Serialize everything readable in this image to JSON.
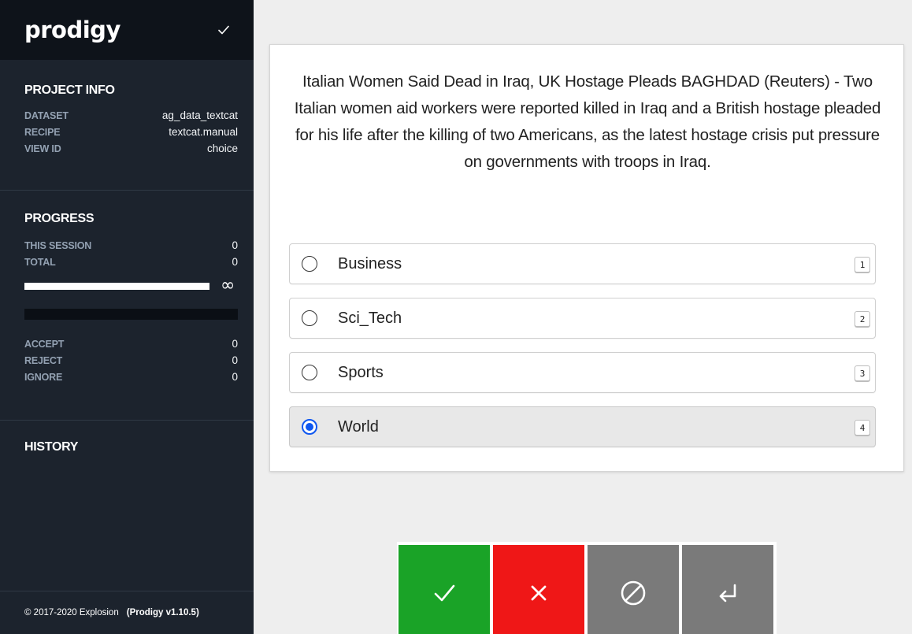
{
  "app": {
    "logo": "prodigy"
  },
  "project_info": {
    "title": "PROJECT INFO",
    "items": [
      {
        "key": "DATASET",
        "value": "ag_data_textcat"
      },
      {
        "key": "RECIPE",
        "value": "textcat.manual"
      },
      {
        "key": "VIEW ID",
        "value": "choice"
      }
    ]
  },
  "progress": {
    "title": "PROGRESS",
    "items": [
      {
        "key": "THIS SESSION",
        "value": "0"
      },
      {
        "key": "TOTAL",
        "value": "0"
      }
    ],
    "infinity_symbol": "∞",
    "counts": [
      {
        "key": "ACCEPT",
        "value": "0"
      },
      {
        "key": "REJECT",
        "value": "0"
      },
      {
        "key": "IGNORE",
        "value": "0"
      }
    ]
  },
  "history": {
    "title": "HISTORY"
  },
  "footer": {
    "copyright": "© 2017-2020 Explosion",
    "version": "(Prodigy v1.10.5)"
  },
  "task": {
    "text": "Italian Women Said Dead in Iraq, UK Hostage Pleads BAGHDAD (Reuters) - Two Italian women aid workers were reported killed in Iraq and a British hostage pleaded for his life after the killing of two Americans, as the latest hostage crisis put pressure on governments with troops in Iraq.",
    "options": [
      {
        "label": "Business",
        "key": "1",
        "selected": false
      },
      {
        "label": "Sci_Tech",
        "key": "2",
        "selected": false
      },
      {
        "label": "Sports",
        "key": "3",
        "selected": false
      },
      {
        "label": "World",
        "key": "4",
        "selected": true
      }
    ]
  },
  "actions": {
    "accept_icon": "check-icon",
    "reject_icon": "x-icon",
    "ignore_icon": "ignore-icon",
    "undo_icon": "undo-icon"
  },
  "colors": {
    "accept": "#1aa327",
    "reject": "#ef1717",
    "ignore": "#7a7a7a",
    "undo": "#7a7a7a",
    "radio_selected": "#0f57f0",
    "sidebar": "#1c232d"
  }
}
